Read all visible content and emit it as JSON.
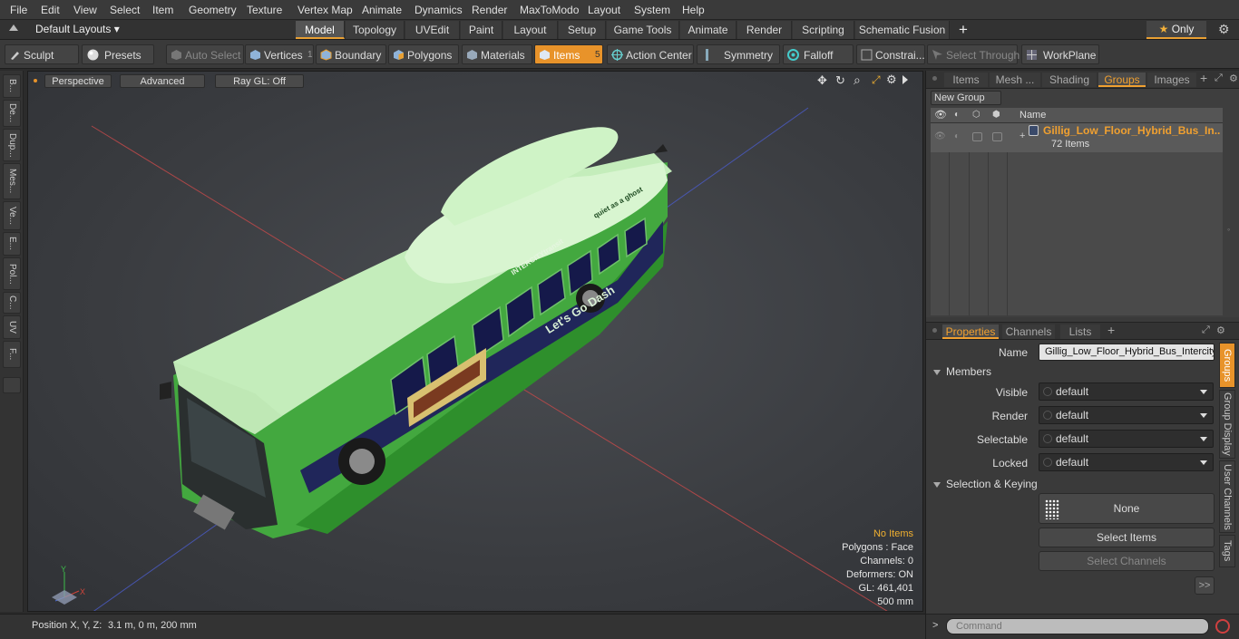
{
  "menu": [
    "File",
    "Edit",
    "View",
    "Select",
    "Item",
    "Geometry",
    "Texture",
    "Vertex Map",
    "Animate",
    "Dynamics",
    "Render",
    "MaxToModo",
    "Layout",
    "System",
    "Help"
  ],
  "layouts_label": "Default Layouts",
  "layout_tabs": [
    "Model",
    "Topology",
    "UVEdit",
    "Paint",
    "Layout",
    "Setup",
    "Game Tools",
    "Animate",
    "Render",
    "Scripting",
    "Schematic Fusion"
  ],
  "only_label": "Only",
  "toolbar": {
    "sculpt": "Sculpt",
    "presets": "Presets",
    "auto_select": "Auto Select",
    "vertices": "Vertices",
    "vertices_count": "1",
    "boundary": "Boundary",
    "polygons": "Polygons",
    "materials": "Materials",
    "items": "Items",
    "items_count": "5",
    "action_center": "Action Center",
    "symmetry": "Symmetry",
    "falloff": "Falloff",
    "constraints": "Constrai...",
    "select_through": "Select Through",
    "workplane": "WorkPlane"
  },
  "left_tabs": [
    "B...",
    "De...",
    "Dup...",
    "Mes...",
    "Ve...",
    "E...",
    "Pol...",
    "C...",
    "UV",
    "F..."
  ],
  "viewport": {
    "perspective": "Perspective",
    "advanced": "Advanced",
    "raygl": "Ray GL: Off",
    "stats": {
      "no_items": "No Items",
      "polygons": "Polygons : Face",
      "channels": "Channels: 0",
      "deformers": "Deformers: ON",
      "gl": "GL: 461,401",
      "scale": "500 mm"
    },
    "bus_texts": {
      "slogan": "Let's Go Dash",
      "brand": "INTERCITYtransit",
      "roof_slogan": "quiet as a ghost"
    }
  },
  "status": {
    "position_label": "Position X, Y, Z:",
    "position_value": "3.1 m, 0 m, 200 mm"
  },
  "top_panel": {
    "tabs": [
      "Items",
      "Mesh ...",
      "Shading",
      "Groups",
      "Images"
    ],
    "active_tab": "Groups",
    "new_group": "New Group",
    "column_name": "Name",
    "group_name": "Gillig_Low_Floor_Hybrid_Bus_In...",
    "group_count": "72 Items"
  },
  "props_panel": {
    "tabs": [
      "Properties",
      "Channels",
      "Lists"
    ],
    "name_label": "Name",
    "name_value": "Gillig_Low_Floor_Hybrid_Bus_Intercity",
    "members": "Members",
    "visible_label": "Visible",
    "render_label": "Render",
    "selectable_label": "Selectable",
    "locked_label": "Locked",
    "default": "default",
    "selection_keying": "Selection & Keying",
    "none": "None",
    "select_items": "Select Items",
    "select_channels": "Select Channels",
    "more": ">>",
    "side_tabs": [
      "Groups",
      "Group Display",
      "User Channels",
      "Tags"
    ]
  },
  "command": {
    "prompt": ">",
    "placeholder": "Command"
  },
  "colors": {
    "accent": "#e8932a",
    "bus_green": "#3fa83a",
    "roof_light": "#c5eebc"
  }
}
